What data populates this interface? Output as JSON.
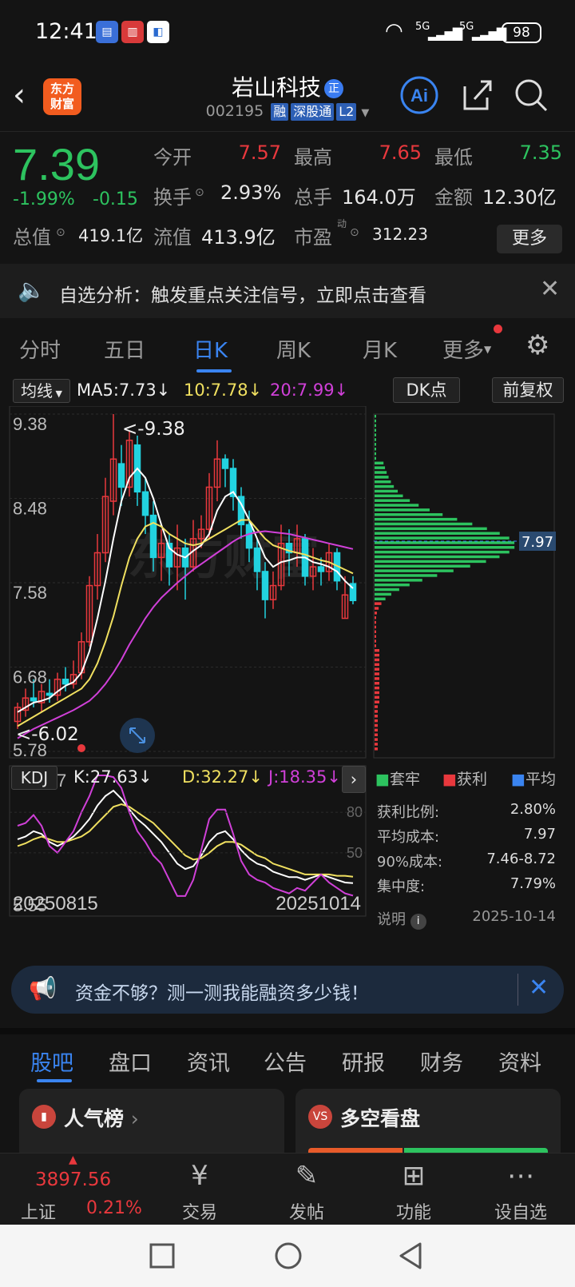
{
  "status_bar": {
    "time": "12:41",
    "battery": "98",
    "net1": "5G",
    "net2": "5G"
  },
  "header": {
    "logo_text_1": "东方",
    "logo_text_2": "财富",
    "title": "岩山科技",
    "title_badge": "正",
    "code": "002195",
    "tags": [
      "融",
      "深股通",
      "L2"
    ]
  },
  "quote": {
    "price": "7.39",
    "change_pct": "-1.99%",
    "change": "-0.15",
    "open_label": "今开",
    "open": "7.57",
    "high_label": "最高",
    "high": "7.65",
    "low_label": "最低",
    "low": "7.35",
    "turnover_label": "换手",
    "turnover": "2.93%",
    "volume_label": "总手",
    "volume": "164.0万",
    "amount_label": "金额",
    "amount": "12.30亿",
    "mktcap_label": "总值",
    "mktcap": "419.1亿",
    "float_label": "流值",
    "float": "413.9亿",
    "pe_label": "市盈",
    "pe_sup": "动",
    "pe": "312.23",
    "more": "更多"
  },
  "notice": {
    "text": "自选分析：触发重点关注信号，立即点击查看"
  },
  "tabs": [
    "分时",
    "五日",
    "日K",
    "周K",
    "月K",
    "更多"
  ],
  "chart_bar": {
    "ma_btn": "均线",
    "ma5": "MA5:7.73↓",
    "ma10": "10:7.78↓",
    "ma20": "20:7.99↓",
    "dk": "DK点",
    "fq": "前复权"
  },
  "kdj_bar": {
    "btn": "KDJ",
    "k": "K:27.63↓",
    "d": "D:32.27↓",
    "j": "J:18.35↓"
  },
  "profile": {
    "legend": [
      "套牢",
      "获利",
      "平均"
    ],
    "stats": [
      {
        "label": "获利比例:",
        "value": "2.80%"
      },
      {
        "label": "平均成本:",
        "value": "7.97"
      },
      {
        "label": "90%成本:",
        "value": "7.46-8.72"
      },
      {
        "label": "集中度:",
        "value": "7.79%"
      }
    ],
    "note": "说明",
    "date": "2025-10-14",
    "avg_label": "7.97"
  },
  "chart_data": [
    {
      "type": "candlestick",
      "title": "",
      "y_ticks": [
        "9.38",
        "8.48",
        "7.58",
        "6.68",
        "5.78"
      ],
      "ylim": [
        5.78,
        9.38
      ],
      "annotations": [
        "<-9.38",
        "<-6.02"
      ],
      "x_labels": [
        "20250815",
        "20251014"
      ],
      "candles": [
        [
          6.1,
          6.25,
          6.02,
          6.3
        ],
        [
          6.22,
          6.35,
          6.15,
          6.45
        ],
        [
          6.35,
          6.32,
          6.25,
          6.55
        ],
        [
          6.3,
          6.42,
          6.2,
          6.5
        ],
        [
          6.4,
          6.38,
          6.3,
          6.55
        ],
        [
          6.38,
          6.55,
          6.32,
          6.62
        ],
        [
          6.55,
          6.5,
          6.42,
          6.68
        ],
        [
          6.5,
          6.6,
          6.45,
          6.75
        ],
        [
          6.62,
          6.95,
          6.55,
          7.05
        ],
        [
          6.95,
          7.55,
          6.9,
          7.65
        ],
        [
          7.55,
          7.9,
          7.4,
          8.1
        ],
        [
          7.9,
          8.5,
          7.8,
          8.7
        ],
        [
          8.45,
          8.9,
          8.3,
          9.38
        ],
        [
          8.85,
          8.6,
          8.4,
          9.05
        ],
        [
          8.6,
          9.1,
          8.5,
          9.2
        ],
        [
          9.05,
          8.55,
          8.4,
          9.15
        ],
        [
          8.55,
          8.3,
          8.1,
          8.7
        ],
        [
          8.3,
          7.85,
          7.7,
          8.45
        ],
        [
          7.85,
          8.0,
          7.6,
          8.15
        ],
        [
          8.0,
          7.75,
          7.55,
          8.1
        ],
        [
          7.75,
          7.95,
          7.5,
          8.2
        ],
        [
          7.95,
          7.75,
          7.4,
          8.05
        ],
        [
          7.75,
          8.05,
          7.7,
          8.25
        ],
        [
          8.05,
          8.15,
          7.95,
          8.3
        ],
        [
          8.15,
          8.6,
          8.05,
          8.75
        ],
        [
          8.6,
          8.9,
          8.45,
          9.1
        ],
        [
          8.9,
          8.8,
          8.6,
          8.95
        ],
        [
          8.8,
          8.5,
          8.35,
          8.9
        ],
        [
          8.5,
          8.2,
          8.05,
          8.6
        ],
        [
          8.2,
          7.95,
          7.8,
          8.35
        ],
        [
          7.95,
          7.7,
          7.5,
          8.05
        ],
        [
          7.7,
          7.4,
          7.2,
          7.8
        ],
        [
          7.4,
          7.55,
          7.3,
          7.7
        ],
        [
          7.55,
          8.0,
          7.5,
          8.2
        ],
        [
          8.0,
          7.9,
          7.65,
          8.15
        ],
        [
          7.9,
          8.05,
          7.75,
          8.2
        ],
        [
          8.05,
          7.65,
          7.55,
          8.1
        ],
        [
          7.65,
          7.75,
          7.5,
          7.95
        ],
        [
          7.75,
          7.7,
          7.55,
          7.85
        ],
        [
          7.7,
          7.9,
          7.6,
          8.0
        ],
        [
          7.9,
          7.6,
          7.5,
          7.95
        ],
        [
          7.2,
          7.45,
          7.2,
          7.65
        ],
        [
          7.57,
          7.39,
          7.35,
          7.65
        ]
      ],
      "series": [
        {
          "name": "MA5",
          "values": [
            6.2,
            6.25,
            6.3,
            6.32,
            6.35,
            6.42,
            6.48,
            6.52,
            6.62,
            6.85,
            7.2,
            7.6,
            8.05,
            8.45,
            8.7,
            8.8,
            8.7,
            8.48,
            8.2,
            7.95,
            7.88,
            7.85,
            7.92,
            7.98,
            8.1,
            8.35,
            8.5,
            8.55,
            8.42,
            8.25,
            8.05,
            7.85,
            7.75,
            7.8,
            7.82,
            7.85,
            7.85,
            7.8,
            7.78,
            7.75,
            7.7,
            7.6,
            7.52
          ]
        },
        {
          "name": "MA10",
          "values": [
            6.05,
            6.1,
            6.15,
            6.2,
            6.25,
            6.3,
            6.35,
            6.4,
            6.45,
            6.55,
            6.72,
            6.95,
            7.22,
            7.55,
            7.85,
            8.05,
            8.18,
            8.22,
            8.18,
            8.1,
            8.05,
            8.0,
            7.98,
            8.0,
            8.05,
            8.1,
            8.15,
            8.2,
            8.25,
            8.25,
            8.15,
            8.05,
            7.98,
            7.95,
            7.92,
            7.9,
            7.88,
            7.85,
            7.82,
            7.8,
            7.76,
            7.72,
            7.68
          ]
        },
        {
          "name": "MA20",
          "values": [
            5.92,
            5.97,
            6.02,
            6.06,
            6.1,
            6.14,
            6.18,
            6.22,
            6.27,
            6.32,
            6.4,
            6.5,
            6.62,
            6.76,
            6.92,
            7.06,
            7.2,
            7.32,
            7.42,
            7.5,
            7.58,
            7.65,
            7.72,
            7.78,
            7.84,
            7.9,
            7.96,
            8.02,
            8.07,
            8.1,
            8.12,
            8.13,
            8.12,
            8.11,
            8.1,
            8.08,
            8.06,
            8.04,
            8.02,
            8.0,
            7.98,
            7.96,
            7.94
          ]
        }
      ]
    },
    {
      "type": "line",
      "title": "",
      "y_ticks": [
        "107.27",
        "80",
        "50",
        "5.55"
      ],
      "ylim": [
        5.55,
        107.27
      ],
      "series": [
        {
          "name": "K",
          "values": [
            60,
            62,
            66,
            64,
            58,
            55,
            58,
            62,
            68,
            75,
            85,
            92,
            96,
            90,
            82,
            75,
            70,
            64,
            58,
            50,
            42,
            38,
            40,
            48,
            58,
            64,
            66,
            60,
            52,
            46,
            42,
            40,
            36,
            34,
            32,
            32,
            30,
            32,
            34,
            32,
            30,
            28,
            27.63
          ]
        },
        {
          "name": "D",
          "values": [
            55,
            57,
            60,
            62,
            60,
            58,
            58,
            60,
            62,
            66,
            72,
            78,
            84,
            86,
            84,
            80,
            76,
            72,
            66,
            60,
            54,
            48,
            45,
            46,
            50,
            55,
            58,
            58,
            56,
            52,
            48,
            46,
            42,
            40,
            38,
            36,
            34,
            34,
            34,
            34,
            33,
            33,
            32.27
          ]
        },
        {
          "name": "J",
          "values": [
            70,
            72,
            78,
            70,
            55,
            50,
            58,
            66,
            80,
            92,
            108,
            110,
            106,
            98,
            80,
            66,
            58,
            48,
            42,
            30,
            18,
            18,
            30,
            52,
            75,
            82,
            82,
            64,
            44,
            34,
            30,
            28,
            24,
            22,
            20,
            24,
            22,
            28,
            34,
            28,
            24,
            20,
            18.35
          ]
        }
      ]
    }
  ],
  "ad": {
    "text": "资金不够？测一测我能融资多少钱！"
  },
  "bottom_tabs": [
    "股吧",
    "盘口",
    "资讯",
    "公告",
    "研报",
    "财务",
    "资料"
  ],
  "cards": [
    {
      "title": "人气榜"
    },
    {
      "title": "多空看盘"
    }
  ],
  "bottom_nav": {
    "index_value": "3897.56",
    "index_name": "上证",
    "index_pct": "0.21%",
    "items": [
      "交易",
      "发帖",
      "功能",
      "设自选"
    ]
  }
}
